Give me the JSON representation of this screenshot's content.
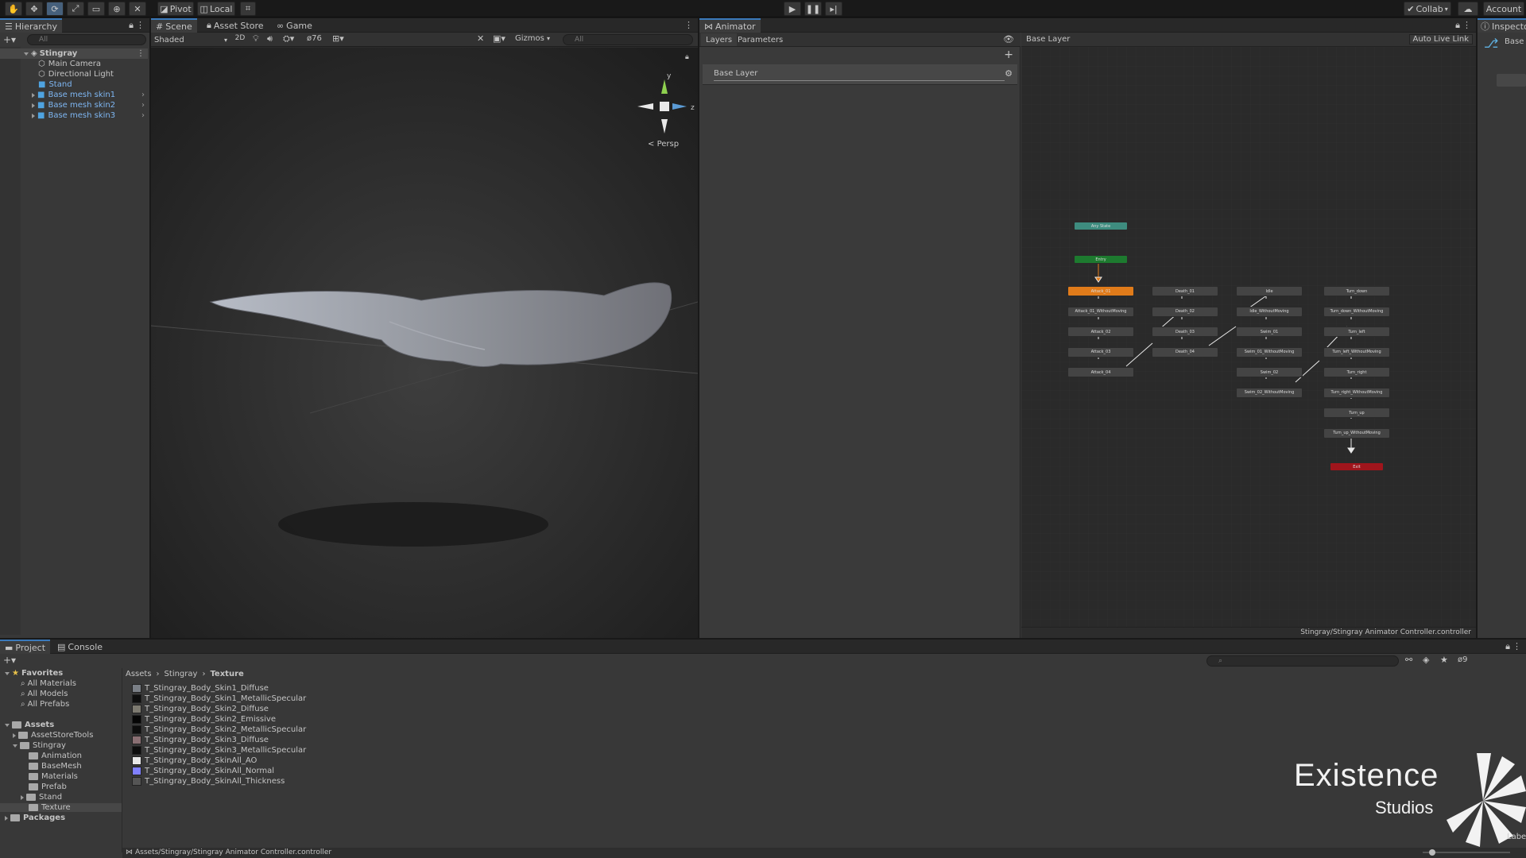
{
  "toolbar": {
    "pivot": "Pivot",
    "local": "Local",
    "collab": "Collab",
    "account": "Account"
  },
  "hierarchy": {
    "tab": "Hierarchy",
    "search_placeholder": "All",
    "root": "Stingray",
    "items": [
      {
        "label": "Main Camera"
      },
      {
        "label": "Directional Light"
      },
      {
        "label": "Stand"
      },
      {
        "label": "Base mesh skin1"
      },
      {
        "label": "Base mesh skin2"
      },
      {
        "label": "Base mesh skin3"
      }
    ]
  },
  "scene": {
    "tabs": [
      "Scene",
      "Asset Store",
      "Game"
    ],
    "shading": "Shaded",
    "mode_2d": "2D",
    "fx_count": "76",
    "gizmos": "Gizmos",
    "search_placeholder": "All",
    "persp": "Persp",
    "axis_y": "y",
    "axis_z": "z"
  },
  "animator": {
    "tab": "Animator",
    "layers": "Layers",
    "parameters": "Parameters",
    "breadcrumb": "Base Layer",
    "live_link": "Auto Live Link",
    "layer_name": "Base Layer",
    "path": "Stingray/Stingray Animator Controller.controller",
    "states": {
      "any": "Any State",
      "entry": "Entry",
      "exit": "Exit",
      "col1": [
        "Attack_01",
        "Attack_01_WithoutMoving",
        "Attack_02",
        "Attack_03",
        "Attack_04"
      ],
      "col2": [
        "Death_01",
        "Death_02",
        "Death_03",
        "Death_04"
      ],
      "col3": [
        "Idle",
        "Idle_WithoutMoving",
        "Swim_01",
        "Swim_01_WithoutMoving",
        "Swim_02",
        "Swim_02_WithoutMoving"
      ],
      "col4": [
        "Turn_down",
        "Turn_down_WithoutMoving",
        "Turn_left",
        "Turn_left_WithoutMoving",
        "Turn_right",
        "Turn_right_WithoutMoving",
        "Turn_up",
        "Turn_up_WithoutMoving"
      ]
    }
  },
  "inspector": {
    "tab": "Inspector",
    "label": "Base"
  },
  "project": {
    "tabs": [
      "Project",
      "Console"
    ],
    "favorites_label": "Favorites",
    "favorites": [
      "All Materials",
      "All Models",
      "All Prefabs"
    ],
    "assets_label": "Assets",
    "tree": [
      "AssetStoreTools",
      "Stingray",
      "Animation",
      "BaseMesh",
      "Materials",
      "Prefab",
      "Stand",
      "Texture"
    ],
    "packages_label": "Packages",
    "breadcrumb": [
      "Assets",
      "Stingray",
      "Texture"
    ],
    "hidden_count": "9",
    "files": [
      {
        "name": "T_Stingray_Body_Skin1_Diffuse",
        "color": "#7a7f86"
      },
      {
        "name": "T_Stingray_Body_Skin1_MetallicSpecular",
        "color": "#0d0d0d"
      },
      {
        "name": "T_Stingray_Body_Skin2_Diffuse",
        "color": "#7d7a70"
      },
      {
        "name": "T_Stingray_Body_Skin2_Emissive",
        "color": "#050505"
      },
      {
        "name": "T_Stingray_Body_Skin2_MetallicSpecular",
        "color": "#0d0d0d"
      },
      {
        "name": "T_Stingray_Body_Skin3_Diffuse",
        "color": "#8a6f73"
      },
      {
        "name": "T_Stingray_Body_Skin3_MetallicSpecular",
        "color": "#0d0d0d"
      },
      {
        "name": "T_Stingray_Body_SkinAll_AO",
        "color": "#e8e8e8"
      },
      {
        "name": "T_Stingray_Body_SkinAll_Normal",
        "color": "#8080ff"
      },
      {
        "name": "T_Stingray_Body_SkinAll_Thickness",
        "color": "#555555"
      }
    ],
    "status_path": "Assets/Stingray/Stingray Animator Controller.controller"
  },
  "watermark": {
    "line1": "Existence",
    "line2": "Studios",
    "partial": "Labe"
  },
  "colors": {
    "accent": "#3a79bb",
    "selected_state": "#e07b1a",
    "entry": "#1d7a2f",
    "any_state": "#3e8c7f",
    "exit": "#a0151c"
  }
}
